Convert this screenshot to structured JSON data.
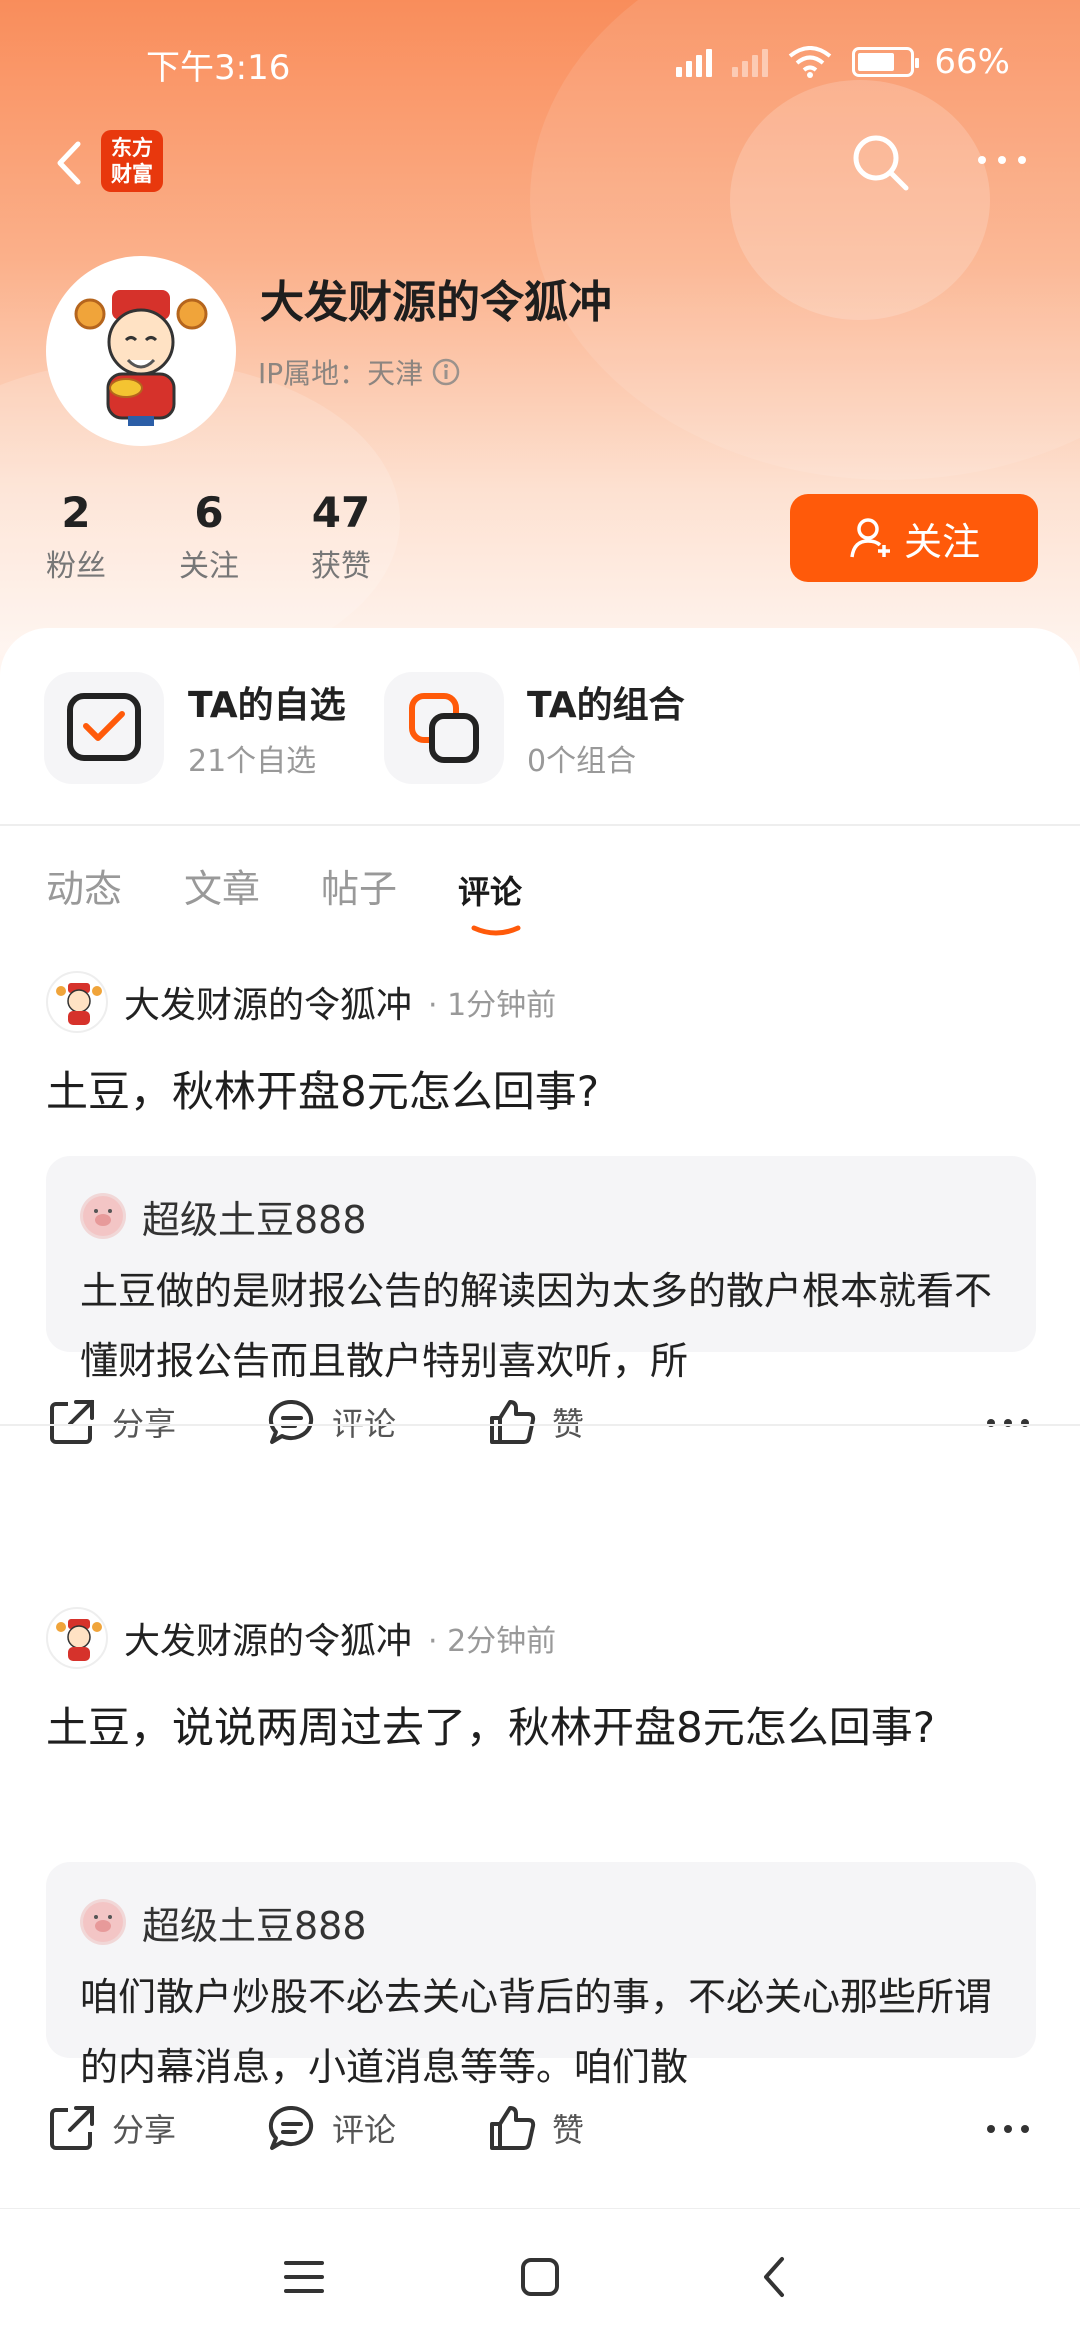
{
  "status_bar": {
    "time": "下午3:16",
    "battery": "66%"
  },
  "nav": {
    "logo_text": "东方财富"
  },
  "profile": {
    "name": "大发财源的令狐冲",
    "ip_location": "IP属地：天津",
    "stats": [
      {
        "value": "2",
        "label": "粉丝"
      },
      {
        "value": "6",
        "label": "关注"
      },
      {
        "value": "47",
        "label": "获赞"
      }
    ],
    "follow_label": "关注"
  },
  "cards": [
    {
      "title": "TA的自选",
      "subtitle": "21个自选",
      "icon": "checkbox-icon"
    },
    {
      "title": "TA的组合",
      "subtitle": "0个组合",
      "icon": "portfolio-icon"
    }
  ],
  "tabs": [
    {
      "label": "动态",
      "active": false
    },
    {
      "label": "文章",
      "active": false
    },
    {
      "label": "帖子",
      "active": false
    },
    {
      "label": "评论",
      "active": true
    }
  ],
  "posts": [
    {
      "author": "大发财源的令狐冲",
      "time": "· 1分钟前",
      "text": "土豆，秋林开盘8元怎么回事?",
      "quote": {
        "author": "超级土豆888",
        "text": "土豆做的是财报公告的解读因为太多的散户根本就看不懂财报公告而且散户特别喜欢听，所"
      },
      "actions": {
        "share": "分享",
        "comment": "评论",
        "like": "赞"
      }
    },
    {
      "author": "大发财源的令狐冲",
      "time": "· 2分钟前",
      "text": "土豆，说说两周过去了，秋林开盘8元怎么回事?",
      "quote": {
        "author": "超级土豆888",
        "text": "咱们散户炒股不必去关心背后的事，不必关心那些所谓的内幕消息，小道消息等等。咱们散"
      },
      "actions": {
        "share": "分享",
        "comment": "评论",
        "like": "赞"
      }
    }
  ],
  "colors": {
    "accent": "#ff5a0a",
    "header_top": "#f98d5b"
  }
}
